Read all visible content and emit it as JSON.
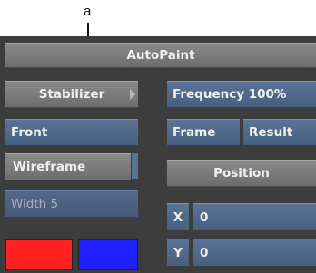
{
  "callout": {
    "label": "a"
  },
  "panel": {
    "title": "AutoPaint",
    "left": {
      "stabilizer_label": "Stabilizer",
      "front_label": "Front",
      "wireframe_label": "Wireframe",
      "width_label": "Width 5",
      "swatch_colors": [
        "#ff2020",
        "#1e1eff"
      ]
    },
    "right": {
      "frequency_label": "Frequency 100%",
      "frame_label": "Frame",
      "result_label": "Result",
      "position_label": "Position",
      "x_label": "X",
      "x_value": "0",
      "y_label": "Y",
      "y_value": "0"
    }
  }
}
